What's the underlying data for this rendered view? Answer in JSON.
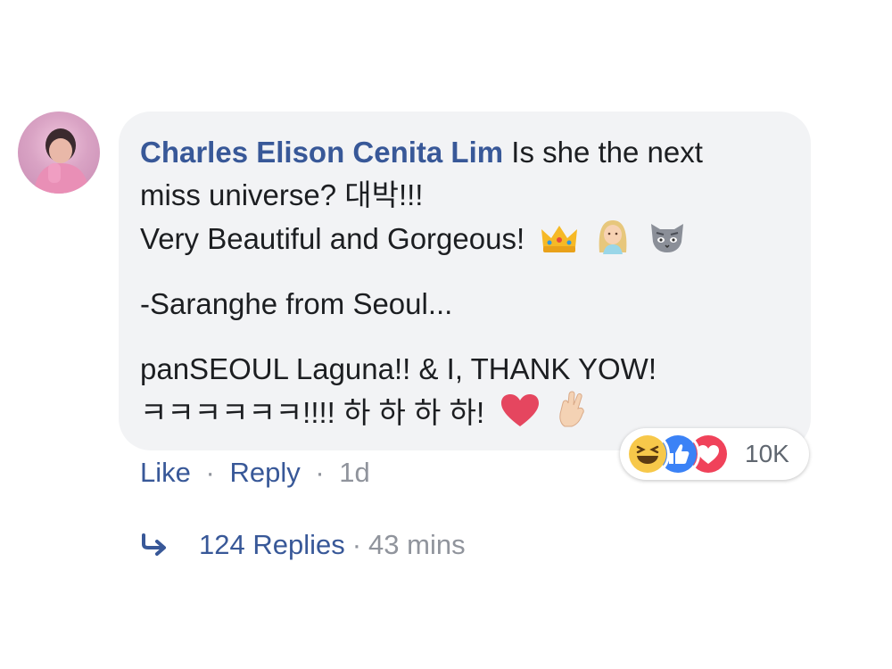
{
  "comment": {
    "author": "Charles Elison Cenita Lim",
    "lines": [
      " Is she the next",
      "miss universe? 대박!!!",
      "Very Beautiful and Gorgeous!",
      "-Saranghe from Seoul...",
      "panSEOUL Laguna!! & I, THANK YOW!",
      "ㅋㅋㅋㅋㅋㅋ!!!! 하 하 하 하!"
    ],
    "emojis": [
      "crown-emoji",
      "woman-emoji",
      "cat-emoji",
      "heart-emoji",
      "crossed-fingers-emoji"
    ]
  },
  "reactions": {
    "icons": [
      "haha-reaction-icon",
      "like-reaction-icon",
      "love-reaction-icon"
    ],
    "count": "10K"
  },
  "actions": {
    "like": "Like",
    "reply": "Reply",
    "sep": "·",
    "time": "1d"
  },
  "replies": {
    "label": "124 Replies",
    "sep": "·",
    "time": "43 mins"
  },
  "colors": {
    "link": "#385898",
    "bubble": "#f2f3f5",
    "meta": "#90949c"
  }
}
